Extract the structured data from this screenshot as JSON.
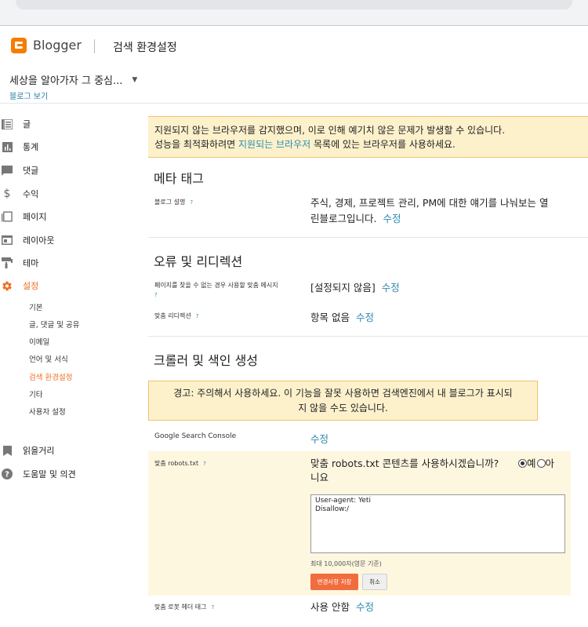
{
  "header": {
    "brand": "Blogger",
    "page_title": "검색 환경설정",
    "menu_icon": "more-vert-icon"
  },
  "blog": {
    "name": "세상을 알아가자 그 중심...",
    "view_link": "블로그 보기"
  },
  "sidebar": {
    "items": [
      {
        "label": "글",
        "icon": "posts-icon"
      },
      {
        "label": "통계",
        "icon": "stats-icon"
      },
      {
        "label": "댓글",
        "icon": "comments-icon"
      },
      {
        "label": "수익",
        "icon": "dollar-icon"
      },
      {
        "label": "페이지",
        "icon": "pages-icon"
      },
      {
        "label": "레이아웃",
        "icon": "layout-icon"
      },
      {
        "label": "테마",
        "icon": "paint-roller-icon"
      },
      {
        "label": "설정",
        "icon": "gear-icon"
      }
    ],
    "settings_sub": [
      "기본",
      "글, 댓글 및 공유",
      "이메일",
      "언어 및 서식",
      "검색 환경설정",
      "기타",
      "사용자 설정"
    ],
    "bottom_items": [
      {
        "label": "읽을거리",
        "icon": "bookmark-icon"
      },
      {
        "label": "도움말 및 의견",
        "icon": "help-icon"
      }
    ]
  },
  "browser_warning": {
    "line1": "지원되지 않는 브라우저를 감지했으며, 이로 인해 예기치 않은 문제가 발생할 수 있습니다.",
    "line2_prefix": "성능을 최적화하려면",
    "line2_link": "지원되는 브라우저",
    "line2_suffix": "목록에 있는 브라우저를 사용하세요."
  },
  "meta": {
    "title": "메타 태그",
    "desc_label": "블로그 설명",
    "desc_value_1": "주식, 경제, 프로젝트 관리, PM에 대한 얘기를 나눠보는 열",
    "desc_value_2": "린블로그입니다.",
    "edit": "수정"
  },
  "errors": {
    "title": "오류 및 리디렉션",
    "notfound_label": "페이지를 찾을 수 없는 경우 사용할 맞춤 메시지",
    "notfound_value": "[설정되지 않음]",
    "redirect_label": "맞춤 리디렉션",
    "redirect_value": "항목 없음",
    "edit": "수정"
  },
  "crawl": {
    "title": "크롤러 및 색인 생성",
    "caution_1": "경고: 주의해서 사용하세요. 이 기능을 잘못 사용하면 검색엔진에서 내 블로그가 표시되",
    "caution_2": "지 않을 수도 있습니다.",
    "gsc_label": "Google Search Console",
    "edit": "수정",
    "robots_label": "맞춤 robots.txt",
    "robots_question_1": "맞춤 robots.txt 콘텐츠를 사용하시겠습니까?",
    "robots_question_2": "니요",
    "yes": "예",
    "no_prefix": "아",
    "robots_content": "User-agent: Yeti\nDisallow:/",
    "limit_note": "최대 10,000자(영문 기준)",
    "save": "변경사항 저장",
    "cancel": "취소",
    "header_tags_label": "맞춤 로봇 헤더 태그",
    "header_tags_value": "사용 안함"
  },
  "help_mark": "?"
}
